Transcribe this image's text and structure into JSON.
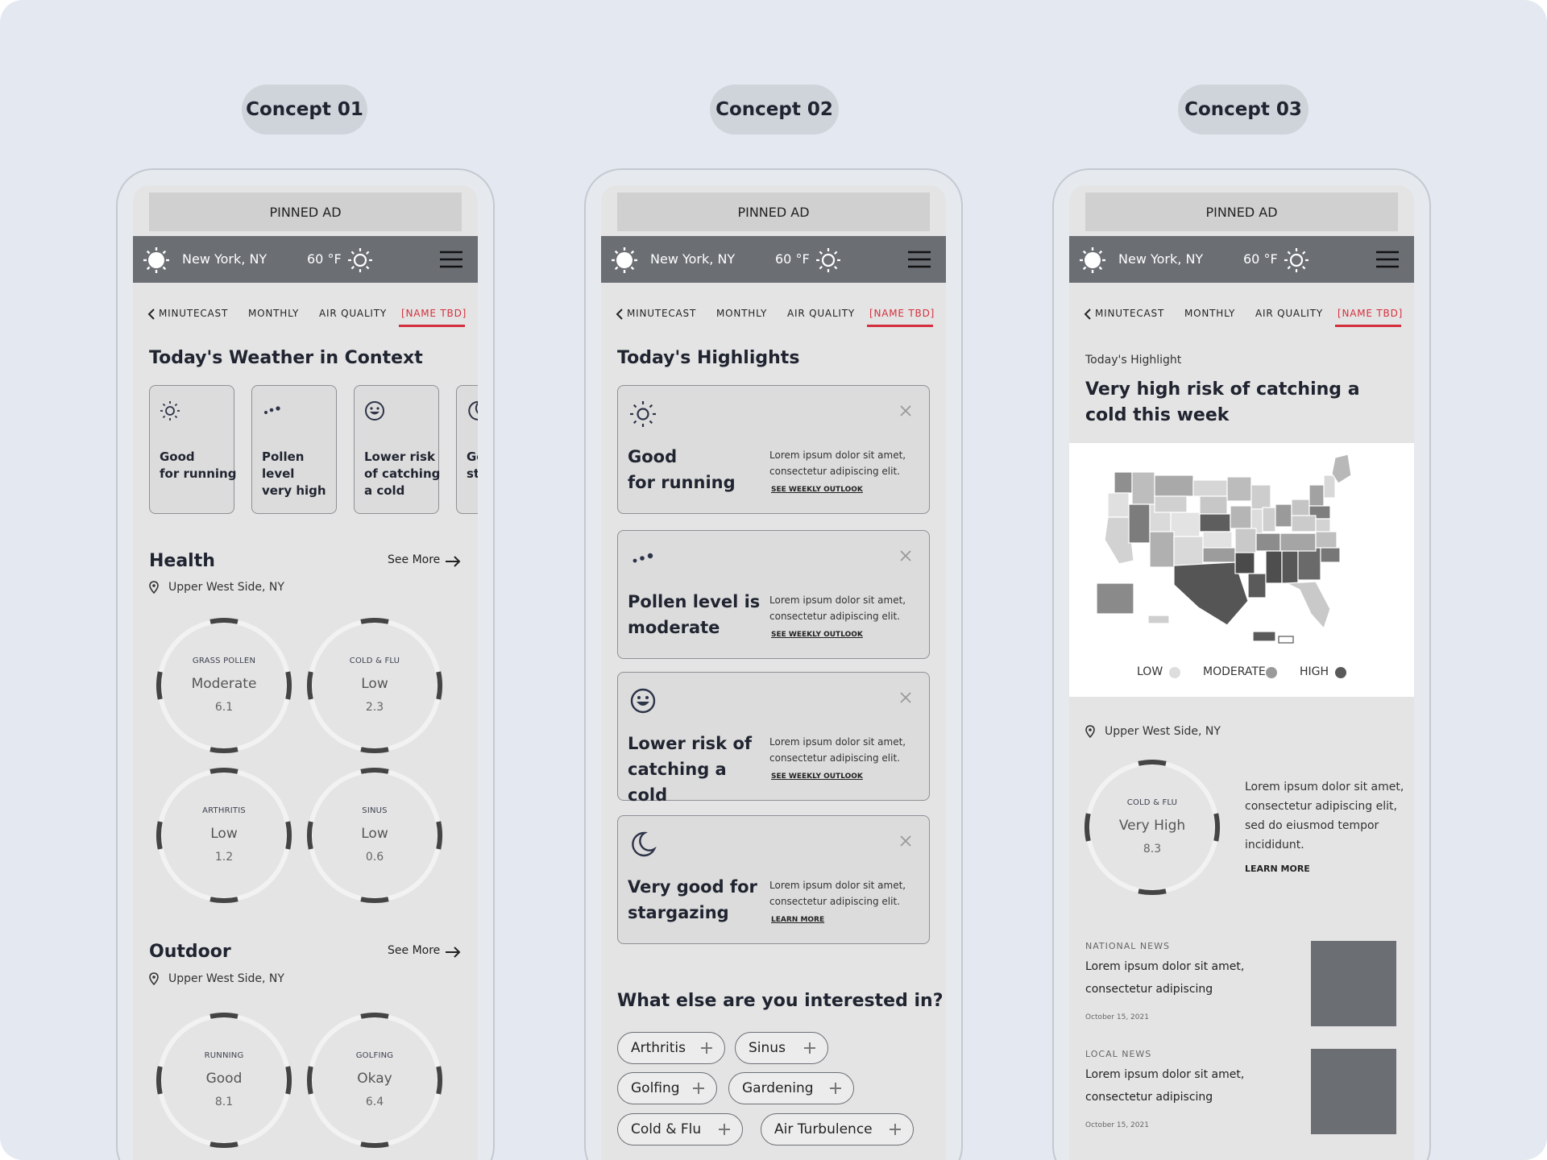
{
  "colors": {
    "background": "#e4e9f1",
    "accent_red": "#d42f3c",
    "topbar": "#6b6e73",
    "risk_low": "#dddddd",
    "risk_moderate": "#9a9a9a",
    "risk_high": "#5a5a5a"
  },
  "concepts": [
    {
      "label": "Concept 01"
    },
    {
      "label": "Concept 02"
    },
    {
      "label": "Concept 03"
    }
  ],
  "common": {
    "ad_label": "PINNED AD",
    "city": "New York, NY",
    "temp": "60 °F",
    "tabs": [
      "MINUTECAST",
      "MONTHLY",
      "AIR QUALITY",
      "[NAME TBD]"
    ],
    "active_tab": "[NAME TBD]",
    "see_more": "See More",
    "location": "Upper West Side, NY",
    "icons": {
      "weather": "sun-icon",
      "menu": "hamburger-menu-icon",
      "back": "chevron-left-icon",
      "location": "map-pin-icon"
    }
  },
  "c1": {
    "heading": "Today's Weather in Context",
    "cards": [
      {
        "icon": "sun-icon",
        "label": "Good\nfor running"
      },
      {
        "icon": "pollen-dots-icon",
        "label": "Pollen\nlevel\nvery high"
      },
      {
        "icon": "smiley-icon",
        "label": "Lower risk\nof catching\na cold"
      },
      {
        "icon": "moon-icon",
        "label": "Go\nst"
      }
    ],
    "health": {
      "title": "Health",
      "gauges": [
        {
          "name": "GRASS POLLEN",
          "level": "Moderate",
          "value": "6.1"
        },
        {
          "name": "COLD & FLU",
          "level": "Low",
          "value": "2.3"
        },
        {
          "name": "ARTHRITIS",
          "level": "Low",
          "value": "1.2"
        },
        {
          "name": "SINUS",
          "level": "Low",
          "value": "0.6"
        }
      ]
    },
    "outdoor": {
      "title": "Outdoor",
      "gauges": [
        {
          "name": "RUNNING",
          "level": "Good",
          "value": "8.1"
        },
        {
          "name": "GOLFING",
          "level": "Okay",
          "value": "6.4"
        }
      ]
    }
  },
  "c2": {
    "heading": "Today's Highlights",
    "lorem": "Lorem ipsum dolor sit amet, consectetur adipiscing elit.",
    "cards": [
      {
        "icon": "sun-icon",
        "title": "Good\nfor running",
        "link": "SEE WEEKLY OUTLOOK"
      },
      {
        "icon": "pollen-dots-icon",
        "title": "Pollen level is moderate",
        "link": "SEE WEEKLY OUTLOOK"
      },
      {
        "icon": "smiley-icon",
        "title": "Lower risk of catching a cold",
        "link": "SEE WEEKLY OUTLOOK"
      },
      {
        "icon": "moon-icon",
        "title": "Very good for stargazing",
        "link": "LEARN MORE"
      }
    ],
    "interests_heading": "What else are you interested in?",
    "chips": [
      "Arthritis",
      "Sinus",
      "Golfing",
      "Gardening",
      "Cold & Flu",
      "Air Turbulence"
    ]
  },
  "c3": {
    "kicker": "Today's Highlight",
    "title": "Very high risk of catching a cold this week",
    "map": {
      "type": "us-choropleth",
      "legend": [
        "LOW",
        "MODERATE",
        "HIGH"
      ],
      "labels": [
        "New York City",
        "District of Columbia",
        "Hawaii",
        "Puerto Rico",
        "Virgin Islands",
        "Guam"
      ]
    },
    "gauge": {
      "name": "COLD & FLU",
      "level": "Very High",
      "value": "8.3"
    },
    "description": "Lorem ipsum dolor sit amet, consectetur adipiscing elit, sed do eiusmod tempor incididunt.",
    "learn_more": "LEARN MORE",
    "news": [
      {
        "kind": "NATIONAL NEWS",
        "headline": "Lorem ipsum dolor sit amet, consectetur adipiscing",
        "date": "October 15, 2021"
      },
      {
        "kind": "LOCAL NEWS",
        "headline": "Lorem ipsum dolor sit amet, consectetur adipiscing",
        "date": "October 15, 2021"
      }
    ]
  }
}
